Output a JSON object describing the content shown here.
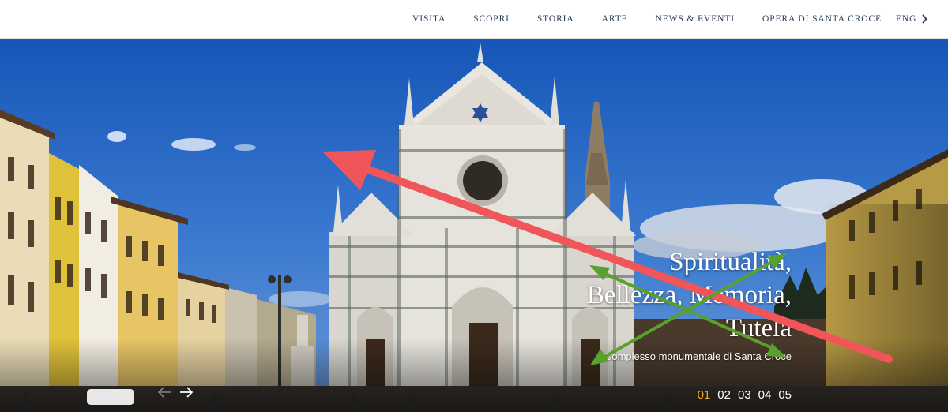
{
  "nav": {
    "items": [
      {
        "label": "VISITA"
      },
      {
        "label": "SCOPRI"
      },
      {
        "label": "STORIA"
      },
      {
        "label": "ARTE"
      },
      {
        "label": "NEWS & EVENTI"
      },
      {
        "label": "OPERA DI SANTA CROCE"
      }
    ],
    "language": "ENG"
  },
  "hero": {
    "heading": {
      "line1": "Spiritualità,",
      "line2": "Bellezza, Memoria,",
      "line3": "Tutela"
    },
    "subtitle": "Complesso monumentale di Santa Croce",
    "pager": {
      "items": [
        "01",
        "02",
        "03",
        "04",
        "05"
      ],
      "active": "01"
    }
  },
  "colors": {
    "nav_text": "#2b3a55",
    "pager_active": "#f5a623",
    "annotation_red": "#f0555a",
    "annotation_green": "#5aa02c"
  },
  "icons": {
    "language": "chevron-right-icon",
    "prev": "arrow-left-icon",
    "next": "arrow-right-icon"
  }
}
